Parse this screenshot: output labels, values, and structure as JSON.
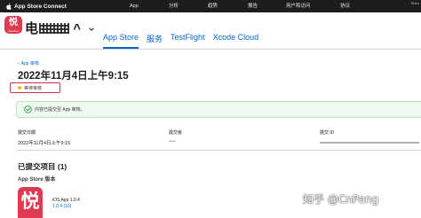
{
  "topbar": {
    "brand": "App Store Connect",
    "nav": [
      "App",
      "分析",
      "趋势",
      "报告",
      "用户和访问",
      "协议"
    ],
    "user": "Shen"
  },
  "app": {
    "icon_glyph": "悦",
    "icon_caption": "Reading",
    "name": "电",
    "name_tail": "^",
    "tabs": [
      "App Store",
      "服务",
      "TestFlight",
      "Xcode Cloud"
    ],
    "active_tab": "App Store"
  },
  "submission": {
    "breadcrumb": "App 审核",
    "title": "2022年11月4日上午9:15",
    "status": "等待审核",
    "banner": "内容已提交至 App 审核。"
  },
  "info": {
    "labels": [
      "提交日期",
      "提交者",
      "提交 ID"
    ],
    "date_value": "2022年11月4日上午9:15",
    "submitter_value": "••••"
  },
  "items": {
    "title": "已提交项目 (1)",
    "section": "App Store 版本",
    "icon_glyph": "悦",
    "name": "iOS App 1.0.4",
    "link": "1.0.4 (10)"
  },
  "watermark": "知乎 @CnPeng",
  "colors": {
    "accent": "#0066cc",
    "brand_red": "#e03a52",
    "status_dot": "#f5b800",
    "highlight_border": "#c8344a",
    "success_bg": "#eef8ee"
  }
}
